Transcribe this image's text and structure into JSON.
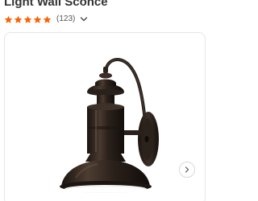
{
  "product": {
    "title": "Light Wall Sconce",
    "rating": {
      "stars_filled": 5,
      "stars_total": 5,
      "review_count": "(123)",
      "star_color": "#f96302"
    }
  },
  "gallery": {
    "next_icon": "chevron-right-icon"
  },
  "colors": {
    "title": "#333333",
    "bronze": "#2a211c",
    "border": "#e6e6e6"
  }
}
